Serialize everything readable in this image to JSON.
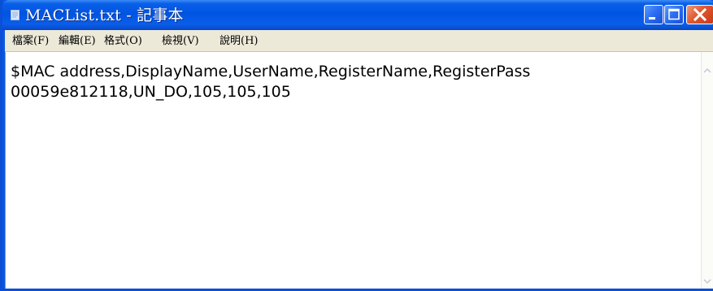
{
  "window": {
    "title": "MACList.txt - 記事本",
    "icon": "notepad-icon",
    "controls": {
      "minimize_icon": "minimize-icon",
      "maximize_icon": "maximize-icon",
      "close_icon": "close-icon"
    }
  },
  "menu": {
    "items": [
      {
        "label": "檔案(F)"
      },
      {
        "label": "編輯(E)"
      },
      {
        "label": "格式(O)"
      },
      {
        "label": "檢視(V)"
      },
      {
        "label": "說明(H)"
      }
    ]
  },
  "editor": {
    "lines": [
      "$MAC address,DisplayName,UserName,RegisterName,RegisterPass",
      "00059e812118,UN_DO,105,105,105"
    ]
  },
  "colors": {
    "titlebar": "#0054e3",
    "close_button": "#e0582e",
    "menubar": "#ece9d8",
    "editor_background": "#ffffff"
  }
}
